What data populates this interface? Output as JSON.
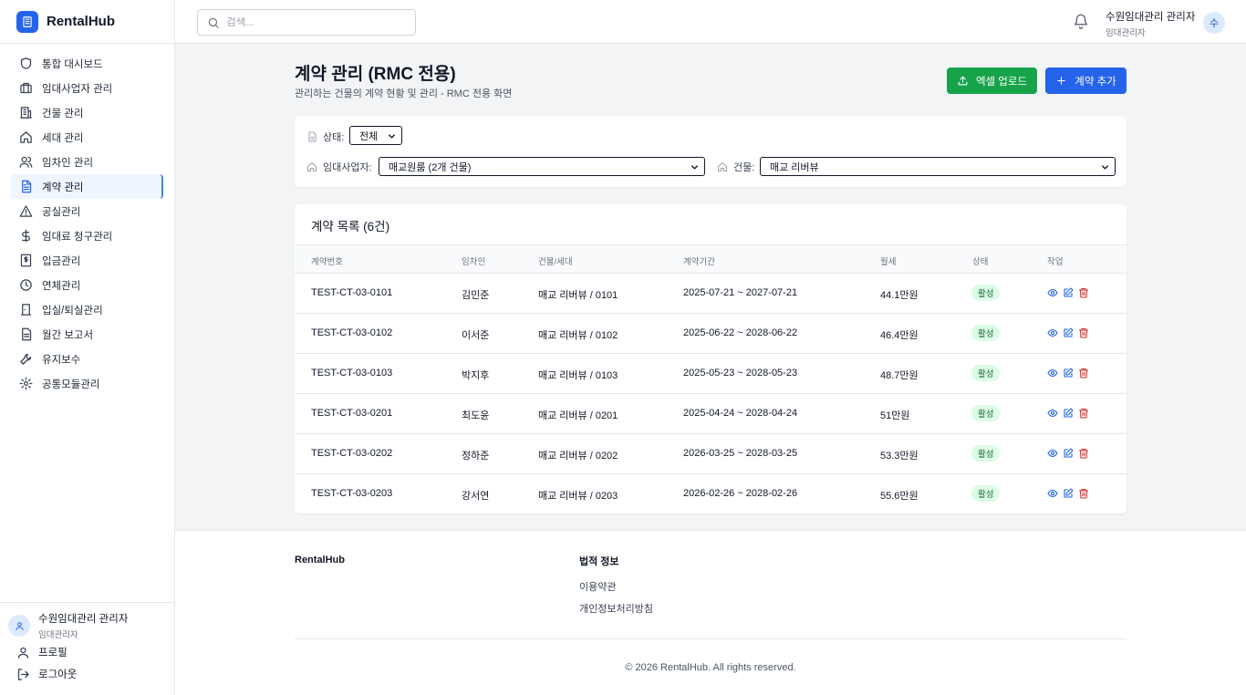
{
  "app": {
    "name": "RentalHub"
  },
  "sidebar": {
    "items": [
      {
        "label": "통합 대시보드",
        "icon": "shield-icon"
      },
      {
        "label": "임대사업자 관리",
        "icon": "briefcase-icon"
      },
      {
        "label": "건물 관리",
        "icon": "building-icon"
      },
      {
        "label": "세대 관리",
        "icon": "home-icon"
      },
      {
        "label": "임차인 관리",
        "icon": "users-icon"
      },
      {
        "label": "계약 관리",
        "icon": "document-icon",
        "active": true
      },
      {
        "label": "공실관리",
        "icon": "warning-icon"
      },
      {
        "label": "임대료 청구관리",
        "icon": "dollar-icon"
      },
      {
        "label": "입금관리",
        "icon": "receipt-icon"
      },
      {
        "label": "연체관리",
        "icon": "clock-icon"
      },
      {
        "label": "입실/퇴실관리",
        "icon": "door-icon"
      },
      {
        "label": "월간 보고서",
        "icon": "report-icon"
      },
      {
        "label": "유지보수",
        "icon": "wrench-icon"
      },
      {
        "label": "공통모듈관리",
        "icon": "gear-icon"
      }
    ],
    "user": {
      "name": "수원임대관리 관리자",
      "role": "임대관리자"
    },
    "profile_label": "프로필",
    "logout_label": "로그아웃"
  },
  "header": {
    "search_placeholder": "검색...",
    "user_name": "수원임대관리 관리자",
    "user_role": "임대관리자",
    "avatar_initial": "수"
  },
  "page": {
    "title": "계약 관리 (RMC 전용)",
    "subtitle": "관리하는 건물의 계약 현황 및 관리 - RMC 전용 화면",
    "excel_upload_label": "엑셀 업로드",
    "add_contract_label": "계약 추가"
  },
  "filters": {
    "status_label": "상태:",
    "status_value": "전체",
    "lessor_label": "임대사업자:",
    "lessor_value": "매교원룸 (2개 건물)",
    "building_label": "건물:",
    "building_value": "매교 리버뷰"
  },
  "contracts": {
    "title": "계약 목록 (6건)",
    "columns": [
      "계약번호",
      "임차인",
      "건물/세대",
      "계약기간",
      "월세",
      "상태",
      "작업"
    ],
    "rows": [
      {
        "id": "TEST-CT-03-0101",
        "tenant": "김민준",
        "unit": "매교 리버뷰 / 0101",
        "period": "2025-07-21 ~ 2027-07-21",
        "rent": "44.1만원",
        "status": "활성"
      },
      {
        "id": "TEST-CT-03-0102",
        "tenant": "이서준",
        "unit": "매교 리버뷰 / 0102",
        "period": "2025-06-22 ~ 2028-06-22",
        "rent": "46.4만원",
        "status": "활성"
      },
      {
        "id": "TEST-CT-03-0103",
        "tenant": "박지후",
        "unit": "매교 리버뷰 / 0103",
        "period": "2025-05-23 ~ 2028-05-23",
        "rent": "48.7만원",
        "status": "활성"
      },
      {
        "id": "TEST-CT-03-0201",
        "tenant": "최도윤",
        "unit": "매교 리버뷰 / 0201",
        "period": "2025-04-24 ~ 2028-04-24",
        "rent": "51만원",
        "status": "활성"
      },
      {
        "id": "TEST-CT-03-0202",
        "tenant": "정하준",
        "unit": "매교 리버뷰 / 0202",
        "period": "2026-03-25 ~ 2028-03-25",
        "rent": "53.3만원",
        "status": "활성"
      },
      {
        "id": "TEST-CT-03-0203",
        "tenant": "강서연",
        "unit": "매교 리버뷰 / 0203",
        "period": "2026-02-26 ~ 2028-02-26",
        "rent": "55.6만원",
        "status": "활성"
      }
    ]
  },
  "footer": {
    "brand": "RentalHub",
    "legal_title": "법적 정보",
    "terms_label": "이용약관",
    "privacy_label": "개인정보처리방침",
    "copyright": "© 2026 RentalHub. All rights reserved."
  },
  "colors": {
    "primary": "#2563eb",
    "success": "#16a34a",
    "badge_bg": "#dcfce7",
    "badge_text": "#166534",
    "danger": "#dc2626"
  }
}
